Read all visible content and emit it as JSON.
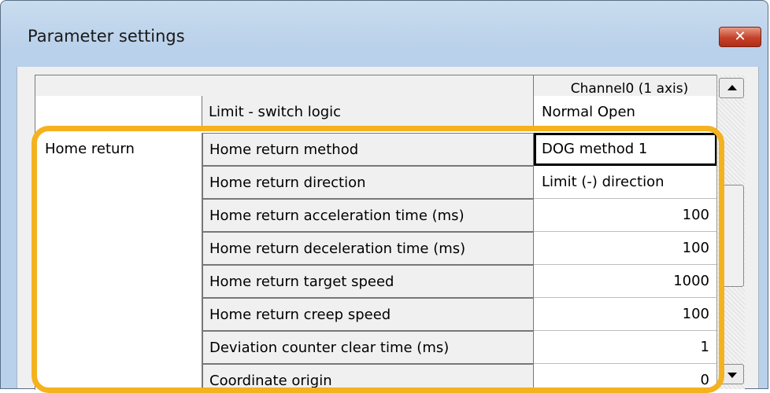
{
  "window": {
    "title": "Parameter settings",
    "close_label": "✕"
  },
  "grid": {
    "column_header": "Channel0 (1 axis)",
    "rows": [
      {
        "category": "",
        "name": "Limit - switch logic",
        "value": "Normal Open"
      },
      {
        "category": "Home return",
        "name": "Home return method",
        "value": "DOG method 1"
      },
      {
        "category": "",
        "name": "Home return direction",
        "value": "Limit (-) direction"
      },
      {
        "category": "",
        "name": "Home return acceleration time (ms)",
        "value": "100"
      },
      {
        "category": "",
        "name": "Home return deceleration time (ms)",
        "value": "100"
      },
      {
        "category": "",
        "name": "Home return target speed",
        "value": "1000"
      },
      {
        "category": "",
        "name": "Home return creep speed",
        "value": "100"
      },
      {
        "category": "",
        "name": "Deviation counter clear time (ms)",
        "value": "1"
      },
      {
        "category": "",
        "name": "Coordinate origin",
        "value": "0"
      }
    ]
  },
  "colors": {
    "highlight": "#f5b21f",
    "close_button": "#c4412a"
  },
  "icons": {
    "close": "close-icon",
    "scroll_up": "arrow-up-icon",
    "scroll_down": "arrow-down-icon"
  }
}
